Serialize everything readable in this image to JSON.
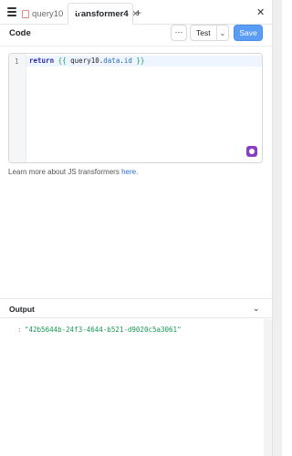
{
  "tabs": [
    {
      "label": "query10",
      "icon": "file-icon",
      "active": false
    },
    {
      "label": "transformer4",
      "icon": "function-icon",
      "active": true
    }
  ],
  "toolbar": {
    "title": "Code",
    "more_label": "···",
    "test_label": "Test",
    "save_label": "Save"
  },
  "editor": {
    "line_number": "1",
    "code": {
      "keyword": "return",
      "open": "{{",
      "object": "query10",
      "dot1": ".",
      "prop1": "data",
      "dot2": ".",
      "prop2": "id",
      "close": "}}"
    }
  },
  "help": {
    "prefix": "Learn more about JS transformers ",
    "link": "here",
    "suffix": "."
  },
  "output": {
    "title": "Output",
    "colon": ":",
    "value": "\"42b5644b-24f3-4644-b521-d9020c5a3061\""
  },
  "colors": {
    "save_button": "#5b9df5",
    "link": "#2b6fd6",
    "output_value": "#1a9a55",
    "ai_icon": "#8a3fc2"
  }
}
